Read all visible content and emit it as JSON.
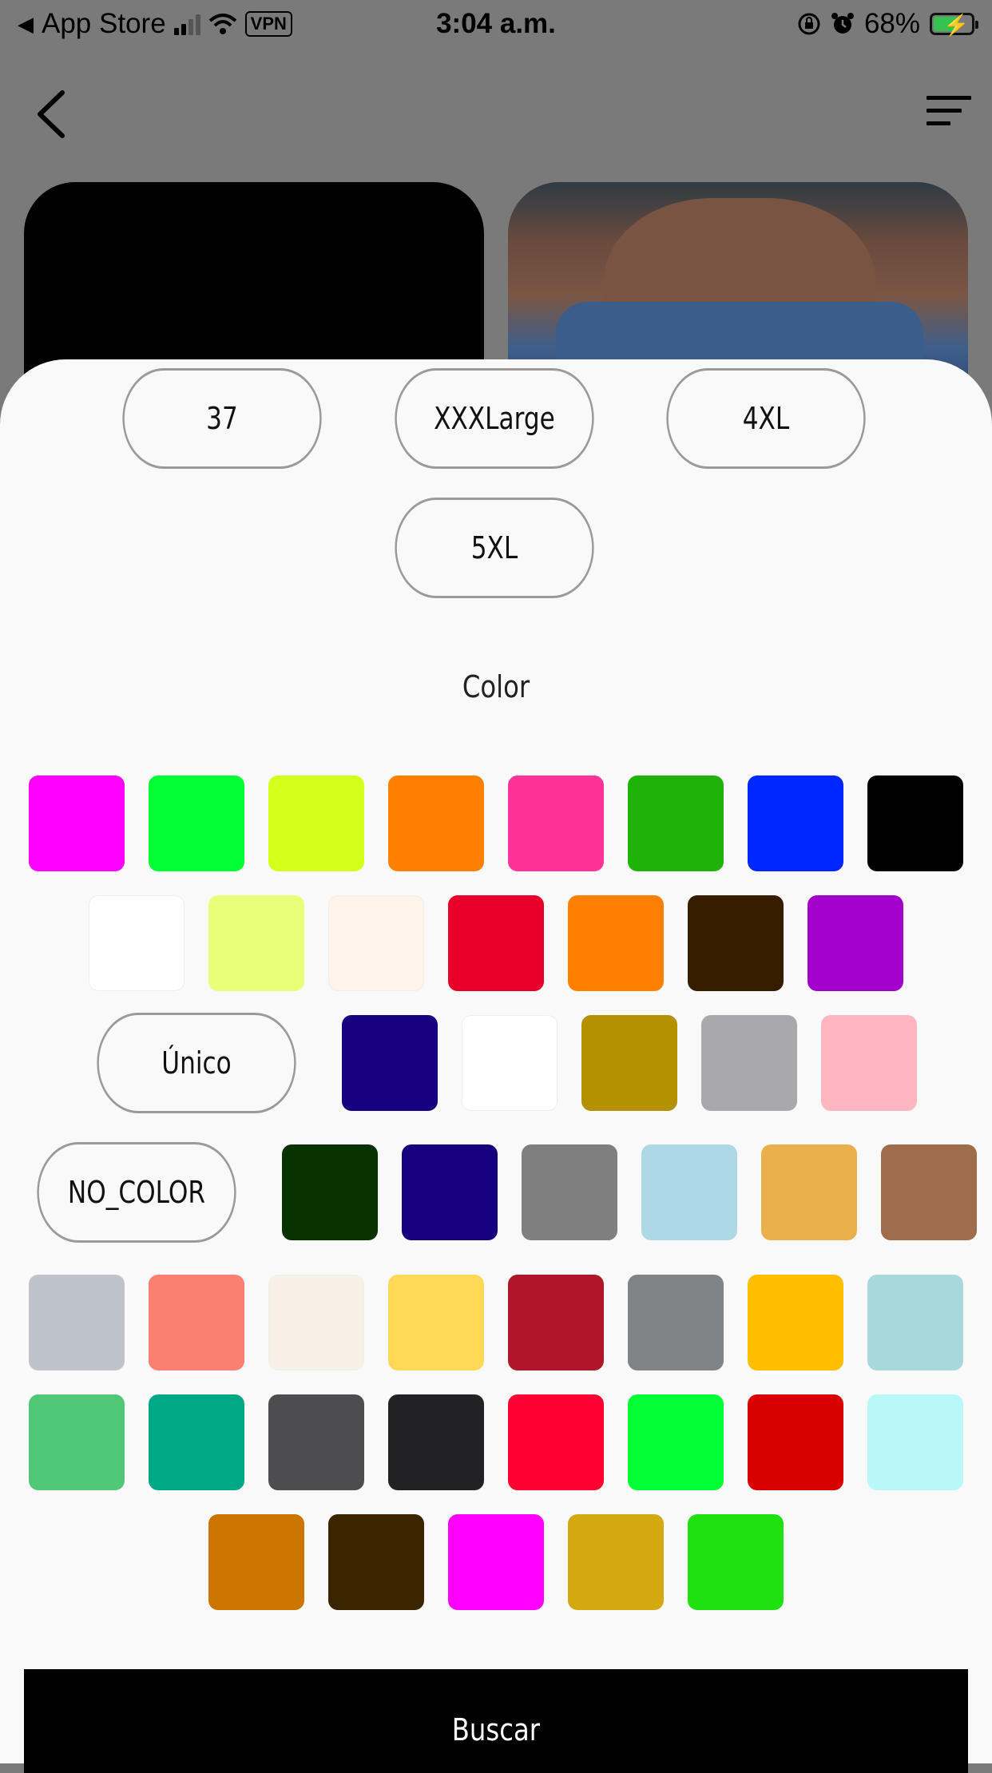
{
  "status_bar": {
    "back_app": "App Store",
    "vpn": "VPN",
    "time": "3:04 a.m.",
    "battery": "68%",
    "battery_level": 0.68
  },
  "size_options": [
    {
      "label": "37"
    },
    {
      "label": "XXXLarge"
    },
    {
      "label": "4XL"
    },
    {
      "label": "5XL"
    }
  ],
  "color_section": {
    "title": "Color",
    "rows": [
      [
        "#ff00ff",
        "#00ff33",
        "#d4ff1a",
        "#ff7f00",
        "#ff3399",
        "#1fb30a",
        "#0027ff",
        "#000000"
      ],
      [
        "#ffffff",
        "#e9ff7a",
        "#fff3ea",
        "#e8002a",
        "#ff7f00",
        "#361d00",
        "#a300cc"
      ],
      [
        "Único",
        "#160080",
        "#ffffff",
        "#b39100",
        "#a9a9ad",
        "#ffb6c1"
      ],
      [
        "NO_COLOR",
        "#083300",
        "#160080",
        "#7f7f7f",
        "#add8e6",
        "#eab04c",
        "#a06d4c"
      ],
      [
        "#bec2cb",
        "#fa8072",
        "#f7f0e6",
        "#ffd955",
        "#b0152a",
        "#818487",
        "#ffbf00",
        "#a8d8dc"
      ],
      [
        "#50c878",
        "#00a885",
        "#4d4d4f",
        "#222225",
        "#ff0033",
        "#00ff33",
        "#d90000",
        "#b8f8f9"
      ],
      [
        "#cc7500",
        "#3b2500",
        "#ff00ff",
        "#d4a811",
        "#1fe010"
      ]
    ]
  },
  "submit_label": "Buscar"
}
